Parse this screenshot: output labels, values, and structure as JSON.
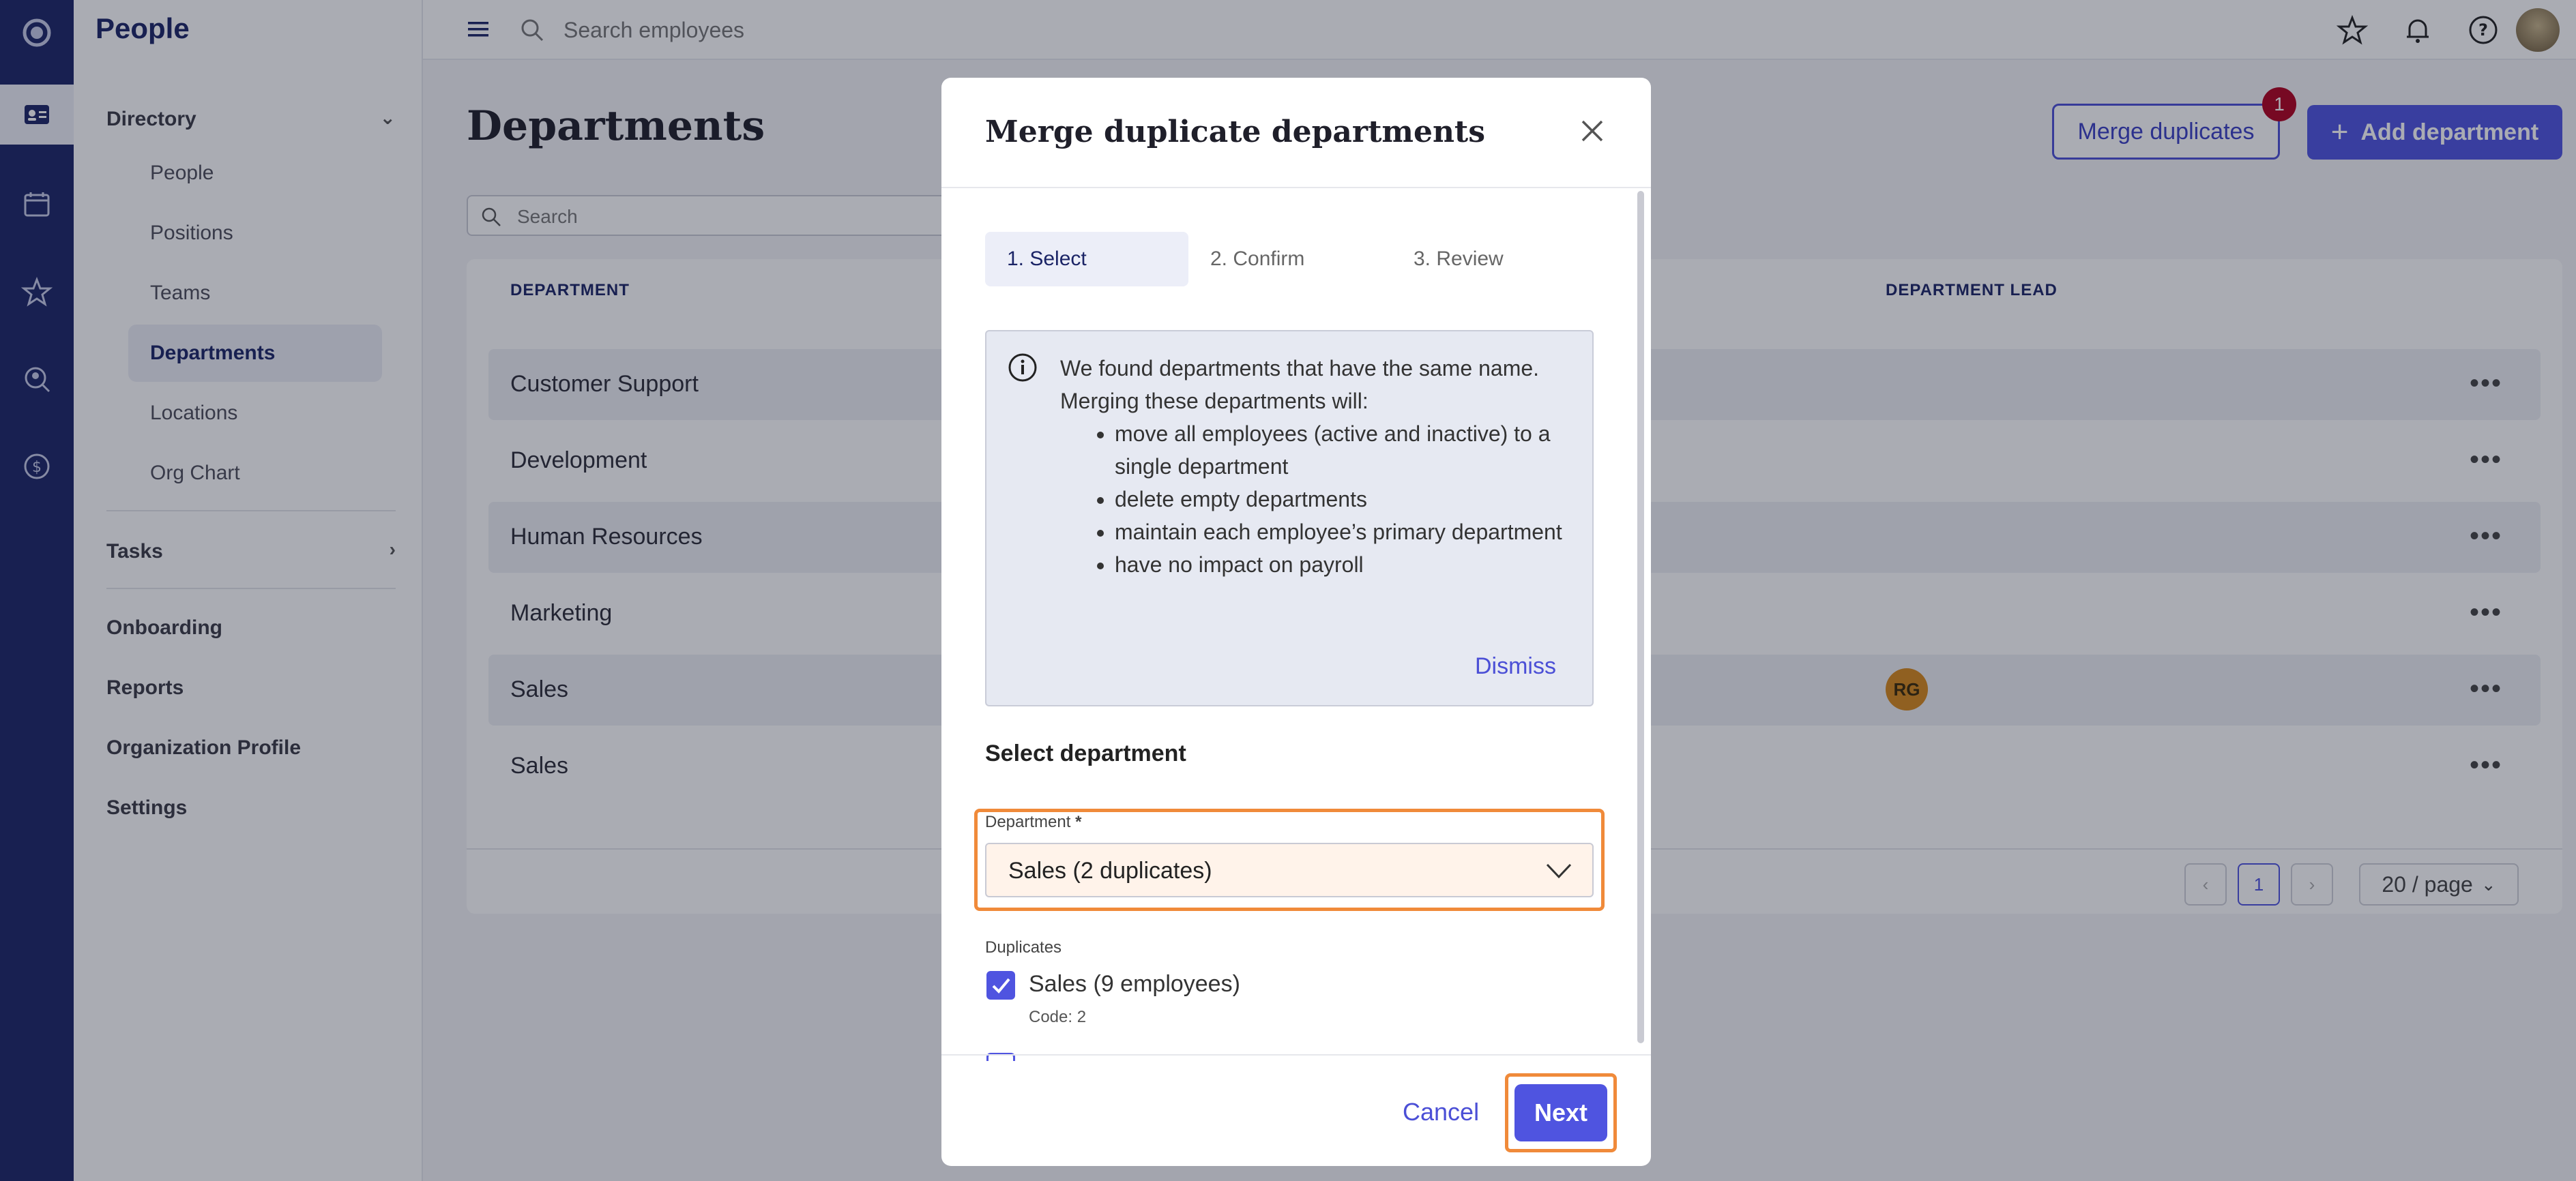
{
  "app": {
    "title": "People"
  },
  "rail": {
    "icons": [
      "logo-icon",
      "directory-icon",
      "calendar-icon",
      "star-icon",
      "search-person-icon",
      "dollar-icon"
    ]
  },
  "sidebar": {
    "directory": "Directory",
    "sub_items": [
      "People",
      "Positions",
      "Teams",
      "Departments",
      "Locations",
      "Org Chart"
    ],
    "tasks": "Tasks",
    "onboarding": "Onboarding",
    "reports": "Reports",
    "org_profile": "Organization Profile",
    "settings": "Settings"
  },
  "topbar": {
    "search_placeholder": "Search employees"
  },
  "main": {
    "title": "Departments",
    "merge_button": "Merge duplicates",
    "merge_badge": "1",
    "add_button": "Add department",
    "search_placeholder": "Search",
    "columns": [
      "DEPARTMENT",
      "DEPARTMENT LEAD"
    ],
    "rows": [
      {
        "name": "Customer Support"
      },
      {
        "name": "Development"
      },
      {
        "name": "Human Resources"
      },
      {
        "name": "Marketing"
      },
      {
        "name": "Sales",
        "lead": "RG"
      },
      {
        "name": "Sales"
      }
    ],
    "pager": {
      "current": "1",
      "page_size": "20 / page"
    }
  },
  "modal": {
    "title": "Merge duplicate departments",
    "steps": [
      "1. Select",
      "2. Confirm",
      "3. Review"
    ],
    "info": {
      "intro_1": "We found departments that have the same name.",
      "intro_2": "Merging these departments will:",
      "bullets": [
        "move all employees (active and inactive) to a single department",
        "delete empty departments",
        "maintain each employee’s primary department",
        "have no impact on payroll"
      ],
      "dismiss": "Dismiss"
    },
    "section_title": "Select department",
    "field_label": "Department",
    "required_mark": "*",
    "selected_department": "Sales (2 duplicates)",
    "duplicates_label": "Duplicates",
    "duplicates": [
      {
        "name": "Sales (9 employees)",
        "code": "Code: 2",
        "checked": true
      }
    ],
    "cancel": "Cancel",
    "next": "Next"
  }
}
